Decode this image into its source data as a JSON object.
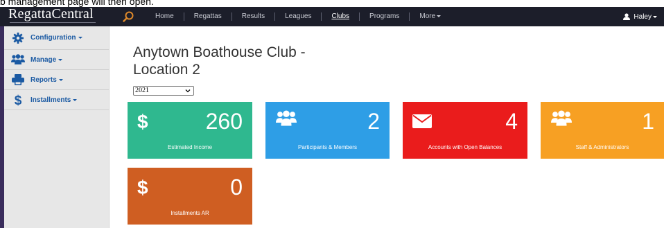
{
  "caption": "b management page will then open.",
  "navbar": {
    "brand": "RegattaCentral",
    "links": [
      {
        "label": "Home"
      },
      {
        "label": "Regattas"
      },
      {
        "label": "Results"
      },
      {
        "label": "Leagues"
      },
      {
        "label": "Clubs"
      },
      {
        "label": "Programs"
      },
      {
        "label": "More"
      }
    ],
    "active": "Clubs",
    "user": "Haley"
  },
  "sidebar": {
    "items": [
      {
        "label": "Configuration",
        "icon": "gear-icon"
      },
      {
        "label": "Manage",
        "icon": "users-icon"
      },
      {
        "label": "Reports",
        "icon": "printer-icon"
      },
      {
        "label": "Installments",
        "icon": "dollar-icon"
      }
    ]
  },
  "main": {
    "title_line1": "Anytown Boathouse Club -",
    "title_line2": "Location 2",
    "year": "2021"
  },
  "tiles": [
    {
      "value": "260",
      "label": "Estimated Income",
      "icon": "dollar-icon",
      "color": "#2fb88f"
    },
    {
      "value": "2",
      "label": "Participants & Members",
      "icon": "users-icon",
      "color": "#2e9ee6"
    },
    {
      "value": "4",
      "label": "Accounts with Open Balances",
      "icon": "envelope-icon",
      "color": "#ea1c1c"
    },
    {
      "value": "1",
      "label": "Staff & Administrators",
      "icon": "users-icon",
      "color": "#f7a023"
    },
    {
      "value": "0",
      "label": "Installments AR",
      "icon": "dollar-icon",
      "color": "#cf5e22"
    }
  ],
  "colors": {
    "navbar": "#1c1e2a",
    "sidebar": "#e7e7e7",
    "link": "#1b5aa3"
  }
}
